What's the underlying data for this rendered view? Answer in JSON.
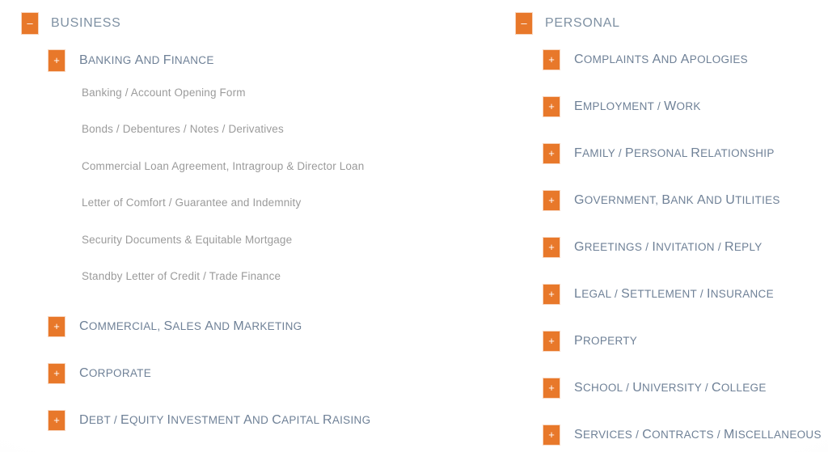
{
  "theme": {
    "accent": "#e8782a",
    "root_text": "#7f91a3",
    "category_text": "#6f8197",
    "leaf_text": "#9b9b9b",
    "background": "#ffffff"
  },
  "icons": {
    "expanded": "–",
    "collapsed": "+",
    "expanded_name": "minus-icon",
    "collapsed_name": "plus-icon"
  },
  "columns": [
    {
      "id": "business",
      "root": {
        "label": "BUSINESS",
        "state": "expanded",
        "glyph": "–"
      },
      "categories": [
        {
          "label": "Banking and Finance",
          "state": "expanded",
          "glyph": "+",
          "items": [
            "Banking / Account Opening Form",
            "Bonds / Debentures / Notes / Derivatives",
            "Commercial Loan Agreement, Intragroup & Director Loan",
            "Letter of Comfort / Guarantee and Indemnity",
            "Security Documents & Equitable Mortgage",
            "Standby Letter of Credit / Trade Finance"
          ]
        },
        {
          "label": "Commercial, Sales and Marketing",
          "state": "collapsed",
          "glyph": "+",
          "items": []
        },
        {
          "label": "Corporate",
          "state": "collapsed",
          "glyph": "+",
          "items": []
        },
        {
          "label": "Debt / Equity Investment and Capital Raising",
          "state": "collapsed",
          "glyph": "+",
          "items": []
        }
      ]
    },
    {
      "id": "personal",
      "root": {
        "label": "PERSONAL",
        "state": "expanded",
        "glyph": "–"
      },
      "categories": [
        {
          "label": "Complaints and Apologies",
          "state": "collapsed",
          "glyph": "+",
          "items": []
        },
        {
          "label": "Employment / Work",
          "state": "collapsed",
          "glyph": "+",
          "items": []
        },
        {
          "label": "Family / Personal Relationship",
          "state": "collapsed",
          "glyph": "+",
          "items": []
        },
        {
          "label": "Government, Bank and Utilities",
          "state": "collapsed",
          "glyph": "+",
          "items": []
        },
        {
          "label": "Greetings / Invitation / Reply",
          "state": "collapsed",
          "glyph": "+",
          "items": []
        },
        {
          "label": "Legal / Settlement / Insurance",
          "state": "collapsed",
          "glyph": "+",
          "items": []
        },
        {
          "label": "Property",
          "state": "collapsed",
          "glyph": "+",
          "items": []
        },
        {
          "label": "School / University / College",
          "state": "collapsed",
          "glyph": "+",
          "items": []
        },
        {
          "label": "Services / Contracts / Miscellaneous",
          "state": "collapsed",
          "glyph": "+",
          "items": []
        }
      ]
    }
  ]
}
